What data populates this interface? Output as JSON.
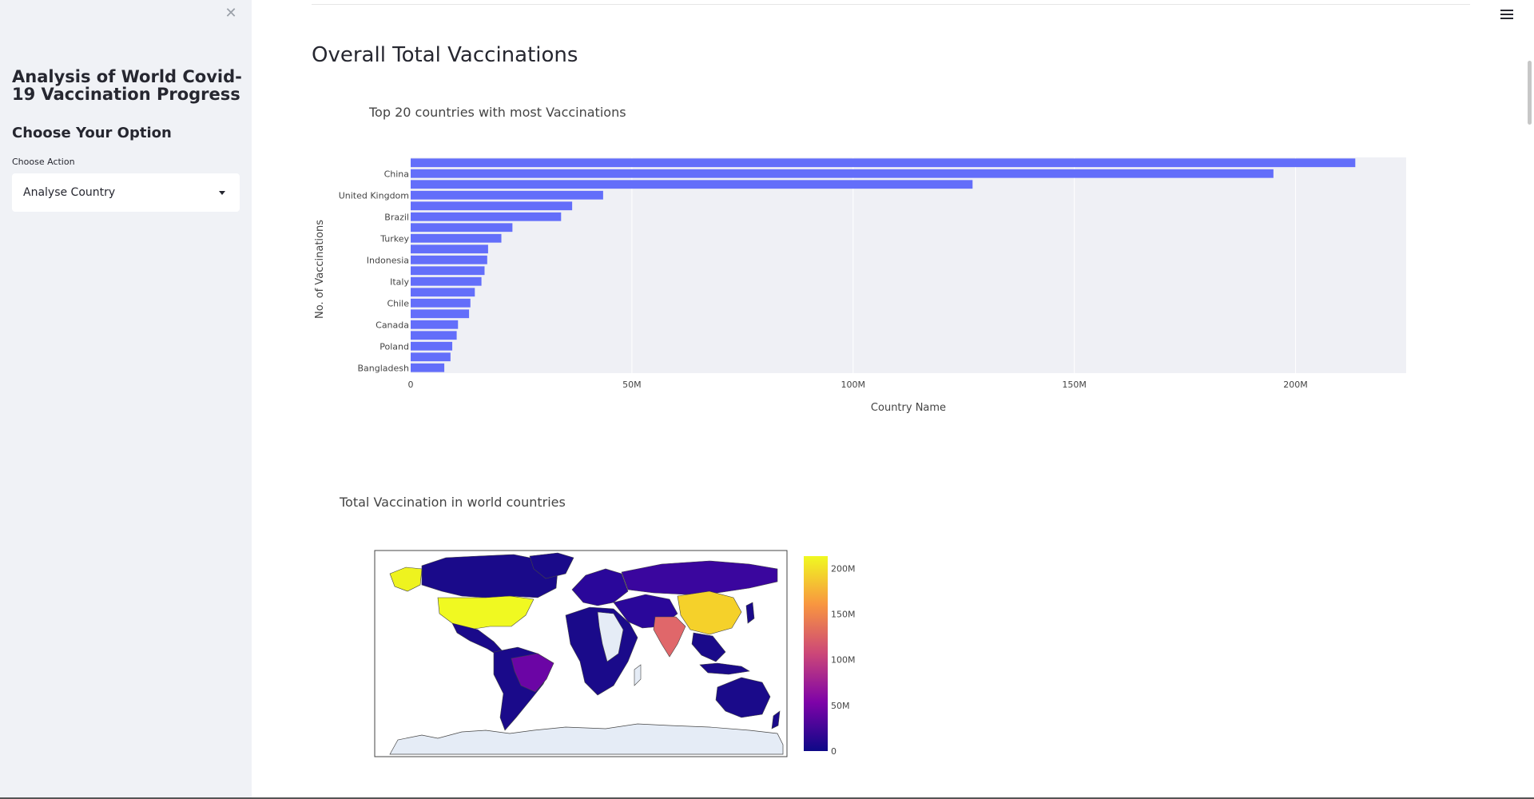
{
  "sidebar": {
    "close_icon": "close-icon",
    "title": "Analysis of World Covid-19 Vaccination Progress",
    "subtitle": "Choose Your Option",
    "select_label": "Choose Action",
    "select_value": "Analyse Country"
  },
  "header": {
    "menu_icon": "hamburger-menu-icon"
  },
  "main": {
    "title": "Overall Total Vaccinations"
  },
  "chart_data": [
    {
      "type": "bar",
      "orientation": "horizontal",
      "title": "Top 20 countries with most Vaccinations",
      "xlabel": "Country Name",
      "ylabel": "No. of Vaccinations",
      "bar_color": "#636efa",
      "plot_bg": "#eff0f5",
      "xlim": [
        0,
        225000000
      ],
      "xticks": [
        {
          "value": 0,
          "label": "0"
        },
        {
          "value": 50000000,
          "label": "50M"
        },
        {
          "value": 100000000,
          "label": "100M"
        },
        {
          "value": 150000000,
          "label": "150M"
        },
        {
          "value": 200000000,
          "label": "200M"
        }
      ],
      "categories": [
        "",
        "China",
        "",
        "United Kingdom",
        "",
        "Brazil",
        "",
        "Turkey",
        "",
        "Indonesia",
        "",
        "Italy",
        "",
        "Chile",
        "",
        "Canada",
        "",
        "Poland",
        "",
        "Bangladesh"
      ],
      "values": [
        213500000,
        195000000,
        127000000,
        43500000,
        36500000,
        34000000,
        23000000,
        20500000,
        17500000,
        17300000,
        16700000,
        16000000,
        14500000,
        13500000,
        13200000,
        10700000,
        10400000,
        9400000,
        9000000,
        7600000
      ]
    },
    {
      "type": "map",
      "title": "Total Vaccination in world countries",
      "colorscale": [
        "#0d0887",
        "#7e03a8",
        "#cc4778",
        "#f89540",
        "#f0f921"
      ],
      "colorbar_ticks": [
        "0",
        "50M",
        "100M",
        "150M",
        "200M"
      ],
      "colorbar_range": [
        0,
        213500000
      ]
    }
  ]
}
